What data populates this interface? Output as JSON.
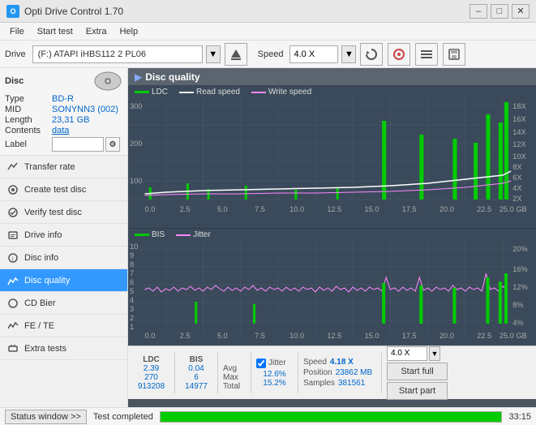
{
  "titlebar": {
    "title": "Opti Drive Control 1.70",
    "icon": "O",
    "controls": [
      "minimize",
      "maximize",
      "close"
    ]
  },
  "menubar": {
    "items": [
      "File",
      "Start test",
      "Extra",
      "Help"
    ]
  },
  "drivebar": {
    "drive_label": "Drive",
    "drive_value": "(F:) ATAPI iHBS112  2 PL06",
    "speed_label": "Speed",
    "speed_value": "4.0 X"
  },
  "disc": {
    "title": "Disc",
    "type_label": "Type",
    "type_value": "BD-R",
    "mid_label": "MID",
    "mid_value": "SONYNN3 (002)",
    "length_label": "Length",
    "length_value": "23,31 GB",
    "contents_label": "Contents",
    "contents_value": "data",
    "label_label": "Label",
    "label_value": ""
  },
  "nav": {
    "items": [
      {
        "id": "transfer-rate",
        "label": "Transfer rate",
        "active": false
      },
      {
        "id": "create-test-disc",
        "label": "Create test disc",
        "active": false
      },
      {
        "id": "verify-test-disc",
        "label": "Verify test disc",
        "active": false
      },
      {
        "id": "drive-info",
        "label": "Drive info",
        "active": false
      },
      {
        "id": "disc-info",
        "label": "Disc info",
        "active": false
      },
      {
        "id": "disc-quality",
        "label": "Disc quality",
        "active": true
      },
      {
        "id": "cd-bier",
        "label": "CD Bier",
        "active": false
      },
      {
        "id": "fe-te",
        "label": "FE / TE",
        "active": false
      },
      {
        "id": "extra-tests",
        "label": "Extra tests",
        "active": false
      }
    ]
  },
  "content": {
    "title": "Disc quality",
    "chart_top": {
      "legend": [
        {
          "label": "LDC",
          "color": "#00cc00"
        },
        {
          "label": "Read speed",
          "color": "white"
        },
        {
          "label": "Write speed",
          "color": "#ff88ff"
        }
      ],
      "y_axis_left": [
        "300",
        "200",
        "100"
      ],
      "y_axis_right": [
        "18X",
        "16X",
        "14X",
        "12X",
        "10X",
        "8X",
        "6X",
        "4X",
        "2X"
      ],
      "x_axis": [
        "0.0",
        "2.5",
        "5.0",
        "7.5",
        "10.0",
        "12.5",
        "15.0",
        "17.5",
        "20.0",
        "22.5",
        "25.0 GB"
      ]
    },
    "chart_bottom": {
      "legend": [
        {
          "label": "BIS",
          "color": "#00cc00"
        },
        {
          "label": "Jitter",
          "color": "#ff88ff"
        }
      ],
      "y_axis_left": [
        "10",
        "9",
        "8",
        "7",
        "6",
        "5",
        "4",
        "3",
        "2",
        "1"
      ],
      "y_axis_right": [
        "20%",
        "16%",
        "12%",
        "8%",
        "4%"
      ],
      "x_axis": [
        "0.0",
        "2.5",
        "5.0",
        "7.5",
        "10.0",
        "12.5",
        "15.0",
        "17.5",
        "20.0",
        "22.5",
        "25.0 GB"
      ]
    }
  },
  "stats": {
    "ldc_label": "LDC",
    "bis_label": "BIS",
    "jitter_label": "Jitter",
    "jitter_checked": true,
    "speed_label": "Speed",
    "speed_value": "4.18 X",
    "speed_combo": "4.0 X",
    "avg_label": "Avg",
    "avg_ldc": "2.39",
    "avg_bis": "0.04",
    "avg_jitter": "12.6%",
    "max_label": "Max",
    "max_ldc": "270",
    "max_bis": "6",
    "max_jitter": "15.2%",
    "position_label": "Position",
    "position_value": "23862 MB",
    "total_label": "Total",
    "total_ldc": "913208",
    "total_bis": "14977",
    "samples_label": "Samples",
    "samples_value": "381561",
    "start_full_label": "Start full",
    "start_part_label": "Start part"
  },
  "statusbar": {
    "btn_label": "Status window >>",
    "status_text": "Test completed",
    "progress": 100,
    "time": "33:15"
  }
}
